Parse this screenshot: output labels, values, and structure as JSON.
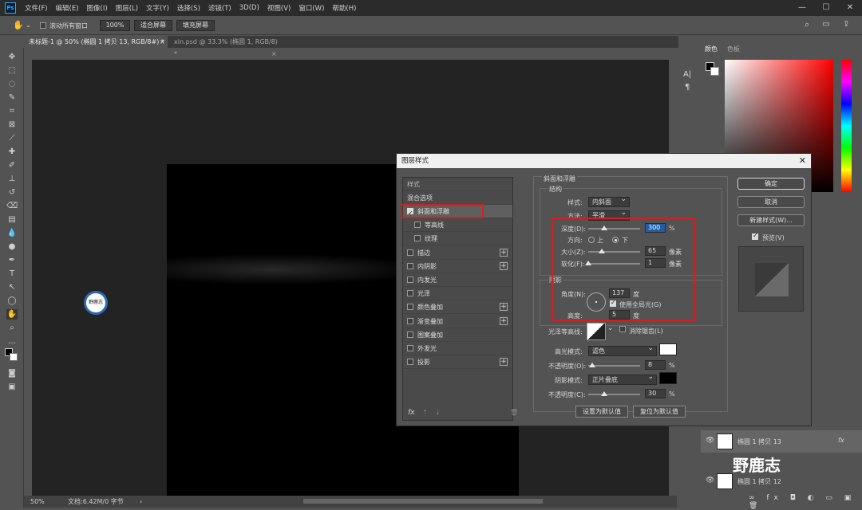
{
  "app": {
    "logo": "Ps"
  },
  "menu": [
    "文件(F)",
    "编辑(E)",
    "图像(I)",
    "图层(L)",
    "文字(Y)",
    "选择(S)",
    "滤镜(T)",
    "3D(D)",
    "视图(V)",
    "窗口(W)",
    "帮助(H)"
  ],
  "window_controls": {
    "minimize": "—",
    "maximize": "☐",
    "close": "✕"
  },
  "options_bar": {
    "scroll_all_label": "滚动所有窗口",
    "zoom_value": "100%",
    "fit_screen": "适合屏幕",
    "fill_screen": "填充屏幕"
  },
  "tabs": [
    {
      "label": "未标题-1 @ 50% (椭圆 1 拷贝 13, RGB/8#) *",
      "close": "×"
    },
    {
      "label": "xin.psd @ 33.3% (椭圆 1, RGB/8) *",
      "close": "×"
    }
  ],
  "status": {
    "zoom": "50%",
    "doc": "文档:6.42M/0 字节"
  },
  "color_panel": {
    "tab_color": "颜色",
    "tab_swatches": "色板"
  },
  "layers": [
    {
      "name": "椭圆 1 拷贝 13",
      "fx": "fx"
    },
    {
      "name": "椭圆 1 拷贝 12"
    }
  ],
  "watermark": {
    "text": "野鹿志",
    "stamp": "野鹿志"
  },
  "dialog": {
    "title": "图层样式",
    "close": "✕",
    "styles_header": "样式",
    "blend_options": "混合选项",
    "items": [
      {
        "label": "斜面和浮雕",
        "checked": true,
        "plus": false
      },
      {
        "label": "等高线",
        "checked": false,
        "plus": false,
        "sub": true
      },
      {
        "label": "纹理",
        "checked": false,
        "plus": false,
        "sub": true
      },
      {
        "label": "描边",
        "checked": false,
        "plus": true
      },
      {
        "label": "内阴影",
        "checked": false,
        "plus": true
      },
      {
        "label": "内发光",
        "checked": false,
        "plus": false
      },
      {
        "label": "光泽",
        "checked": false,
        "plus": false
      },
      {
        "label": "颜色叠加",
        "checked": false,
        "plus": true
      },
      {
        "label": "渐变叠加",
        "checked": false,
        "plus": true
      },
      {
        "label": "图案叠加",
        "checked": false,
        "plus": false
      },
      {
        "label": "外发光",
        "checked": false,
        "plus": false
      },
      {
        "label": "投影",
        "checked": false,
        "plus": true
      }
    ],
    "fx_label": "fx",
    "section_title": "斜面和浮雕",
    "structure_title": "结构",
    "style_label": "样式:",
    "style_value": "内斜面",
    "technique_label": "方法:",
    "technique_value": "平滑",
    "depth_label": "深度(D):",
    "depth_value": "300",
    "depth_unit": "%",
    "depth_fraction": 0.3,
    "direction_label": "方向:",
    "dir_up": "上",
    "dir_down": "下",
    "size_label": "大小(Z):",
    "size_value": "65",
    "size_unit": "像素",
    "size_fraction": 0.26,
    "soften_label": "软化(F):",
    "soften_value": "1",
    "soften_unit": "像素",
    "soften_fraction": 0.0,
    "shading_title": "阴影",
    "angle_label": "角度(N):",
    "angle_value": "137",
    "angle_unit": "度",
    "global_light_label": "使用全局光(G)",
    "altitude_label": "高度:",
    "altitude_value": "5",
    "altitude_unit": "度",
    "gloss_label": "光泽等高线:",
    "antialias_label": "消除锯齿(L)",
    "highlight_mode_label": "高光模式:",
    "highlight_mode_value": "滤色",
    "highlight_color": "#ffffff",
    "highlight_opacity_label": "不透明度(O):",
    "highlight_opacity_value": "8",
    "highlight_opacity_unit": "%",
    "highlight_opacity_fraction": 0.08,
    "shadow_mode_label": "阴影模式:",
    "shadow_mode_value": "正片叠底",
    "shadow_color": "#000000",
    "shadow_opacity_label": "不透明度(C):",
    "shadow_opacity_value": "30",
    "shadow_opacity_unit": "%",
    "shadow_opacity_fraction": 0.3,
    "make_default": "设置为默认值",
    "reset_default": "复位为默认值",
    "ok": "确定",
    "cancel": "取消",
    "new_style": "新建样式(W)...",
    "preview": "预览(V)"
  }
}
